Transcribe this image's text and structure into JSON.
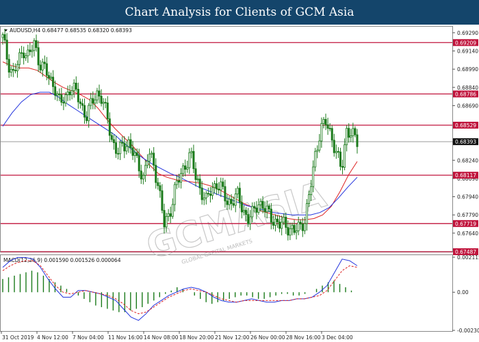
{
  "header": {
    "title": "Chart Analysis for Clients of GCM Asia"
  },
  "chart_data": {
    "type": "candlestick",
    "symbol_info": "AUDUSD,H4  0.68477 0.68535 0.68320 0.68393",
    "price_ticks": [
      "0.69290",
      "0.69140",
      "0.68990",
      "0.68840",
      "0.68690",
      "0.68390",
      "0.68240",
      "0.68090",
      "0.67940",
      "0.67790",
      "0.67640"
    ],
    "price_range": [
      0.67487,
      0.6934
    ],
    "levels": [
      {
        "value": 0.69209,
        "label": "0.69209"
      },
      {
        "value": 0.68786,
        "label": "0.68786"
      },
      {
        "value": 0.68529,
        "label": "0.68529"
      },
      {
        "value": 0.68117,
        "label": "0.68117"
      },
      {
        "value": 0.67719,
        "label": "0.67719"
      },
      {
        "value": 0.67487,
        "label": "0.67487"
      }
    ],
    "current_price": {
      "value": 0.68393,
      "label": "0.68393"
    },
    "x_ticks": [
      "31 Oct 2019",
      "4 Nov 12:00",
      "7 Nov 04:00",
      "11 Nov 16:00",
      "14 Nov 08:00",
      "18 Nov 20:00",
      "21 Nov 12:00",
      "26 Nov 00:00",
      "28 Nov 16:00",
      "3 Dec 04:00"
    ],
    "close_path": [
      0.6925,
      0.6905,
      0.6895,
      0.6905,
      0.6915,
      0.691,
      0.692,
      0.6905,
      0.69,
      0.689,
      0.6885,
      0.687,
      0.6875,
      0.6885,
      0.688,
      0.687,
      0.686,
      0.687,
      0.688,
      0.6875,
      0.686,
      0.684,
      0.683,
      0.6835,
      0.684,
      0.683,
      0.682,
      0.681,
      0.683,
      0.682,
      0.68,
      0.677,
      0.678,
      0.68,
      0.681,
      0.682,
      0.683,
      0.681,
      0.68,
      0.679,
      0.68,
      0.6805,
      0.68,
      0.679,
      0.679,
      0.6795,
      0.6785,
      0.6775,
      0.678,
      0.679,
      0.6785,
      0.678,
      0.6775,
      0.677,
      0.6772,
      0.6768,
      0.6765,
      0.677,
      0.6775,
      0.68,
      0.683,
      0.685,
      0.6855,
      0.6845,
      0.683,
      0.6815,
      0.685,
      0.6845,
      0.6839
    ],
    "ma_fast": [
      0.6905,
      0.6902,
      0.69,
      0.69,
      0.6898,
      0.6893,
      0.6888,
      0.6884,
      0.6881,
      0.6878,
      0.6874,
      0.6867,
      0.6858,
      0.685,
      0.6843,
      0.6836,
      0.6828,
      0.682,
      0.6813,
      0.681,
      0.6808,
      0.6807,
      0.6806,
      0.6805,
      0.6803,
      0.68,
      0.6796,
      0.6792,
      0.6788,
      0.6785,
      0.6782,
      0.678,
      0.6778,
      0.6776,
      0.6775,
      0.6775,
      0.6776,
      0.6779,
      0.6786,
      0.6798,
      0.6812,
      0.6823
    ],
    "ma_slow": [
      0.6852,
      0.6863,
      0.6872,
      0.6878,
      0.688,
      0.688,
      0.6876,
      0.687,
      0.6865,
      0.686,
      0.6855,
      0.685,
      0.6845,
      0.6838,
      0.6832,
      0.6826,
      0.6821,
      0.6817,
      0.6813,
      0.681,
      0.6806,
      0.6802,
      0.6799,
      0.6796,
      0.6793,
      0.679,
      0.6787,
      0.6785,
      0.6783,
      0.6781,
      0.678,
      0.6779,
      0.6779,
      0.6779,
      0.6781,
      0.6785,
      0.6793,
      0.6802,
      0.681
    ],
    "macd": {
      "label": "MACD(12,26,9) 0.001590 0.001526 0.000064",
      "ticks": [
        "0.002115",
        "0.00",
        "-0.002301"
      ],
      "range": [
        -0.002301,
        0.002115
      ],
      "histogram": [
        0.0008,
        0.0009,
        0.001,
        0.0011,
        0.0012,
        0.0013,
        0.0012,
        0.001,
        0.0008,
        0.0006,
        0.0004,
        0.0002,
        0.0,
        -0.0002,
        -0.0004,
        -0.0006,
        -0.0008,
        -0.0009,
        -0.001,
        -0.0011,
        -0.0012,
        -0.0012,
        -0.0011,
        -0.001,
        -0.0009,
        -0.0007,
        -0.0005,
        -0.0003,
        -0.0001,
        0.0001,
        0.0003,
        0.0002,
        0.0,
        -0.0002,
        -0.0004,
        -0.0006,
        -0.0007,
        -0.0006,
        -0.0005,
        -0.0004,
        -0.0003,
        -0.0002,
        -0.0002,
        -0.0003,
        -0.0004,
        -0.0004,
        -0.0003,
        -0.0002,
        -0.0001,
        -0.0001,
        -0.0002,
        -0.0002,
        -0.0001,
        0.0,
        0.0002,
        0.0004,
        0.0006,
        0.0007,
        0.0005,
        0.0003,
        0.0001,
        0.0
      ],
      "main": [
        0.0015,
        0.0019,
        0.0021,
        0.0021,
        0.002,
        0.0015,
        0.0008,
        0.0002,
        -0.0003,
        -0.0003,
        0.0001,
        0.0001,
        0.0,
        -0.0001,
        -0.0003,
        -0.0005,
        -0.001,
        -0.0015,
        -0.0017,
        -0.0013,
        -0.0008,
        -0.0005,
        -0.0002,
        0.0,
        0.0002,
        0.0003,
        0.0002,
        0.0,
        -0.0003,
        -0.0005,
        -0.0006,
        -0.0006,
        -0.0005,
        -0.0004,
        -0.0005,
        -0.0006,
        -0.0006,
        -0.0005,
        -0.0005,
        -0.0004,
        -0.0004,
        -0.0003,
        0.0,
        0.0004,
        0.0012,
        0.002,
        0.0019,
        0.0016
      ],
      "signal": [
        0.0013,
        0.0016,
        0.0018,
        0.0019,
        0.0019,
        0.0016,
        0.001,
        0.0004,
        0.0,
        -0.0001,
        0.0,
        0.0001,
        0.0,
        -0.0001,
        -0.0002,
        -0.0004,
        -0.0007,
        -0.0011,
        -0.0013,
        -0.0012,
        -0.0009,
        -0.0006,
        -0.0003,
        -0.0001,
        0.0001,
        0.0002,
        0.0001,
        0.0,
        -0.0002,
        -0.0004,
        -0.0005,
        -0.0006,
        -0.0005,
        -0.0005,
        -0.0005,
        -0.0005,
        -0.0005,
        -0.0005,
        -0.0005,
        -0.0004,
        -0.0004,
        -0.0003,
        -0.0002,
        0.0001,
        0.0007,
        0.0013,
        0.0016,
        0.0015
      ]
    },
    "colors": {
      "candle": "#1a7a1a",
      "level": "#c0143c",
      "ma_fast": "#dd2222",
      "ma_slow": "#2233dd",
      "macd_main": "#2233dd",
      "macd_signal": "#dd2222",
      "header_bg": "#14456b"
    }
  },
  "watermark": {
    "text": "GCMASIA",
    "sub": "GLOBAL CAPITAL MARKETS"
  }
}
